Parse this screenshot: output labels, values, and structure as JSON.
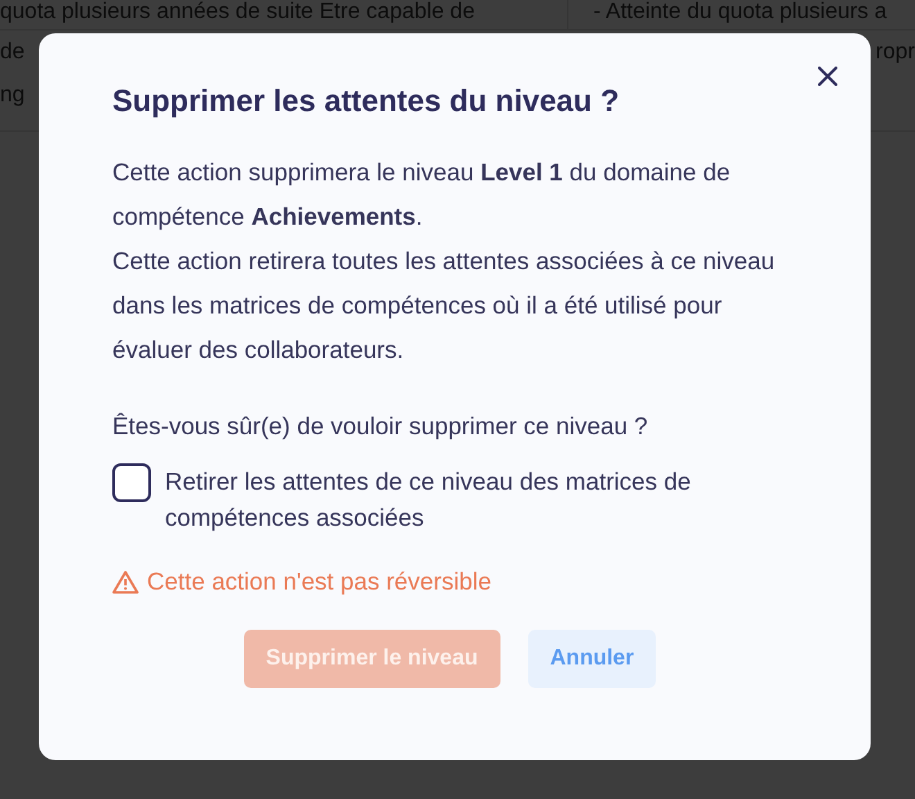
{
  "background_table": {
    "rows": [
      {
        "cells": [
          "quota plusieurs années de suite Etre capable de",
          "- Atteinte du quota plusieurs a"
        ]
      },
      {
        "cells": [
          "de",
          "ropr"
        ]
      },
      {
        "cells": [
          "ng"
        ]
      }
    ]
  },
  "dialog": {
    "title": "Supprimer les attentes du niveau ?",
    "paragraphs": [
      "Cette action supprimera le niveau **Level 1** du domaine de compétence **Achievements**.",
      "Cette action retirera toutes les attentes associées à ce niveau dans les matrices de compétences où il a été utilisé pour évaluer des collaborateurs."
    ],
    "question": "Êtes-vous sûr(e) de vouloir supprimer ce niveau ?",
    "checkbox": {
      "label": "Retirer les attentes de ce niveau des matrices de compétences associées",
      "checked": false
    },
    "warning": "Cette action n'est pas réversible",
    "buttons": [
      {
        "label": "Supprimer le niveau",
        "kind": "danger",
        "disabled": true
      },
      {
        "label": "Annuler",
        "kind": "secondary",
        "disabled": false
      }
    ]
  }
}
